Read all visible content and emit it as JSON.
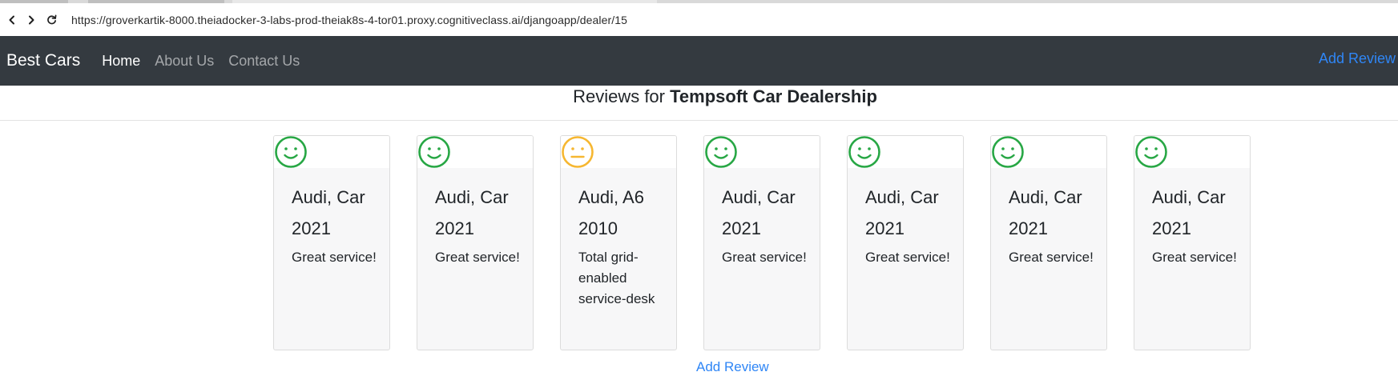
{
  "browser": {
    "url": "https://groverkartik-8000.theiadocker-3-labs-prod-theiak8s-4-tor01.proxy.cognitiveclass.ai/djangoapp/dealer/15",
    "back_icon": "chevron-left-icon",
    "forward_icon": "chevron-right-icon",
    "reload_icon": "reload-icon"
  },
  "navbar": {
    "brand": "Best Cars",
    "links": [
      {
        "label": "Home",
        "active": true
      },
      {
        "label": "About Us",
        "active": false
      },
      {
        "label": "Contact Us",
        "active": false
      }
    ],
    "add_review": "Add Review"
  },
  "header": {
    "prefix": "Reviews for ",
    "dealer_name": "Tempsoft Car Dealership"
  },
  "reviews": [
    {
      "sentiment": "positive",
      "icon": "smile-icon",
      "title": "Audi, Car 2021",
      "text": "Great service!"
    },
    {
      "sentiment": "positive",
      "icon": "smile-icon",
      "title": "Audi, Car 2021",
      "text": "Great service!"
    },
    {
      "sentiment": "neutral",
      "icon": "neutral-face-icon",
      "title": "Audi, A6 2010",
      "text": "Total grid-enabled service-desk"
    },
    {
      "sentiment": "positive",
      "icon": "smile-icon",
      "title": "Audi, Car 2021",
      "text": "Great service!"
    },
    {
      "sentiment": "positive",
      "icon": "smile-icon",
      "title": "Audi, Car 2021",
      "text": "Great service!"
    },
    {
      "sentiment": "positive",
      "icon": "smile-icon",
      "title": "Audi, Car 2021",
      "text": "Great service!"
    },
    {
      "sentiment": "positive",
      "icon": "smile-icon",
      "title": "Audi, Car 2021",
      "text": "Great service!"
    }
  ],
  "footer": {
    "add_review": "Add Review"
  },
  "colors": {
    "navbar_bg": "#343a40",
    "link_blue": "#2f86f6",
    "positive": "#28a745",
    "neutral": "#f6b731"
  }
}
